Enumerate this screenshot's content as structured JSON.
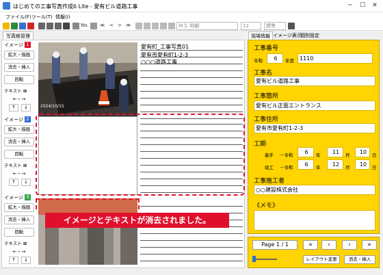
{
  "window": {
    "title": "はじめての工事写真作成6 Lite - 愛有ビル道路工事",
    "min": "─",
    "max": "☐",
    "close": "✕"
  },
  "menu": [
    "ファイル(F)",
    "ツール(T)",
    "情報(I)"
  ],
  "toolbar": {
    "text_no": "No.",
    "font_name": "ＭＳ 明朝",
    "font_size": "12",
    "style": "標準"
  },
  "left_tabs": {
    "photo_ledger": "写真帳管理"
  },
  "slots": [
    {
      "label": "イメージ",
      "num": "1",
      "num_color": "#e0102c",
      "enlarge": "拡大・描画",
      "erase_insert": "消去・挿入",
      "rotate": "回転",
      "text_label": "テキスト",
      "swap": "←・→"
    },
    {
      "label": "イメージ",
      "num": "2",
      "num_color": "#2f6bd1",
      "enlarge": "拡大・描画",
      "erase_insert": "消去・挿入",
      "rotate": "回転",
      "text_label": "テキスト",
      "swap": "←・→"
    },
    {
      "label": "イメージ",
      "num": "3",
      "num_color": "#2ea84a",
      "enlarge": "拡大・描画",
      "erase_insert": "消去・挿入",
      "rotate": "回転",
      "text_label": "テキスト",
      "swap": "←・→"
    }
  ],
  "notes1": [
    "愛有町_工事写真01",
    "愛有市愛有町1-2-3",
    "○○○道路工事"
  ],
  "right_tabs": [
    "現場情報",
    "イメージ表示",
    "個別設定"
  ],
  "site": {
    "construction_no_label": "工事番号",
    "era": "令和",
    "year": "6",
    "year_suffix": "年度",
    "number": "1110",
    "name_label": "工事名",
    "name": "愛有ビル道路工事",
    "place_label": "工事箇所",
    "place": "愛有ビル正面エントランス",
    "address_label": "工事住所",
    "address": "愛有市愛有町1-2-3",
    "period_label": "工期",
    "start_label": "着手",
    "end_label": "竣工",
    "era_prefix": "－令和",
    "start": {
      "y": "6",
      "m": "11",
      "d": "10"
    },
    "end": {
      "y": "6",
      "m": "12",
      "d": "10"
    },
    "unit_y": "年",
    "unit_m": "月",
    "unit_d": "日",
    "contractor_label": "工事施工者",
    "contractor": "○○建設株式会社",
    "memo_label": "《メモ》",
    "memo": ""
  },
  "nav": {
    "page": "Page 1 / 1",
    "layout_change": "レイアウト変更",
    "erase_insert": "消去・挿入"
  },
  "callout": "イメージとテキストが消去されました。",
  "photo_stamp": "2024/10/15"
}
